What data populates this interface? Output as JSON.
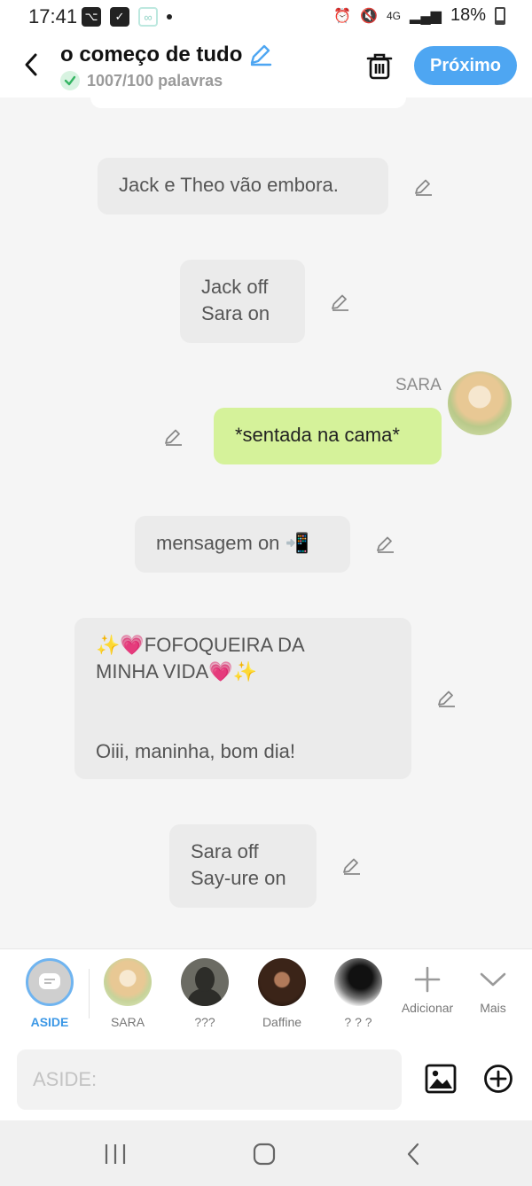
{
  "status_bar": {
    "time": "17:41",
    "network": "4G",
    "battery": "18%",
    "icons": [
      "voicemail-icon",
      "checkbox-icon",
      "link-icon",
      "dot-icon",
      "alarm-icon",
      "mute-icon",
      "signal-icon",
      "battery-icon"
    ]
  },
  "header": {
    "title": "o começo de tudo",
    "word_count": "1007/100 palavras",
    "next_label": "Próximo",
    "accent_color": "#4ea6f2"
  },
  "messages": [
    {
      "type": "narration",
      "text": "Jack e Theo vão embora."
    },
    {
      "type": "narration",
      "text": "Jack off\nSara on"
    },
    {
      "type": "character",
      "speaker": "SARA",
      "text": "*sentada na cama*"
    },
    {
      "type": "narration",
      "text": "mensagem on 📲"
    },
    {
      "type": "narration",
      "text": "✨💗FOFOQUEIRA DA\nMINHA VIDA💗✨\n\n\nOiii, maninha, bom dia!"
    },
    {
      "type": "narration",
      "text": "Sara off\nSay-ure on"
    }
  ],
  "characters": [
    {
      "name": "ASIDE",
      "active": true
    },
    {
      "name": "SARA",
      "active": false
    },
    {
      "name": "???",
      "active": false
    },
    {
      "name": "Daffine",
      "active": false
    },
    {
      "name": "? ? ?",
      "active": false
    }
  ],
  "tools": {
    "add_label": "Adicionar",
    "more_label": "Mais"
  },
  "composer": {
    "placeholder": "ASIDE:"
  },
  "colors": {
    "narration_bubble": "#ebebeb",
    "character_bubble": "#d5f29a",
    "active_label": "#3c98e6"
  }
}
